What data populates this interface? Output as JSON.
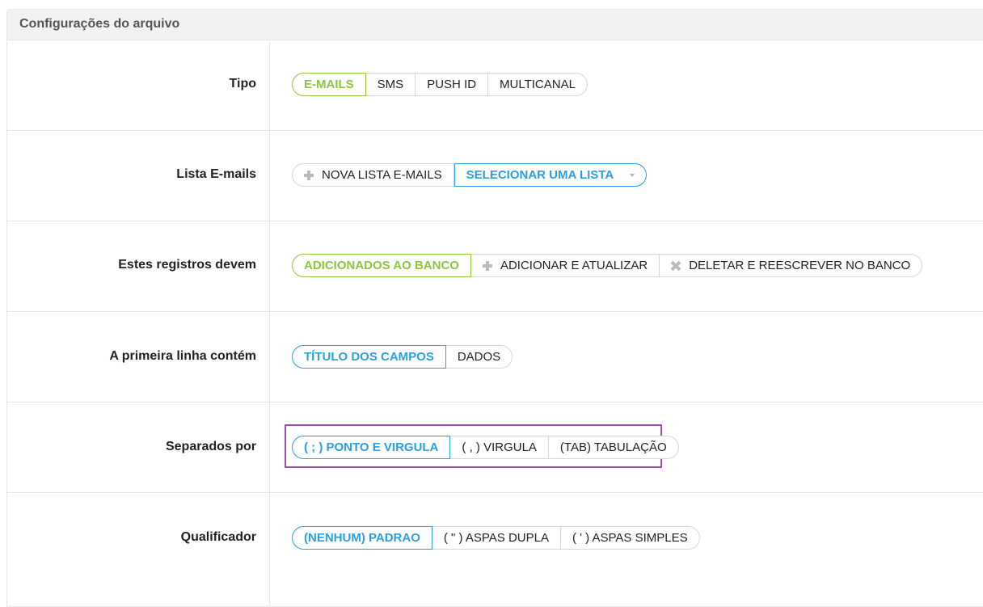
{
  "panel": {
    "title": "Configurações do arquivo"
  },
  "rows": {
    "tipo": {
      "label": "Tipo",
      "options": [
        "E-MAILS",
        "SMS",
        "PUSH ID",
        "MULTICANAL"
      ]
    },
    "lista": {
      "label": "Lista E-mails",
      "new_list": "NOVA LISTA E-MAILS",
      "select_list": "SELECIONAR UMA LISTA"
    },
    "registros": {
      "label": "Estes registros devem",
      "options": [
        "ADICIONADOS AO BANCO",
        "ADICIONAR E ATUALIZAR",
        "DELETAR E REESCREVER NO BANCO"
      ]
    },
    "primeira_linha": {
      "label": "A primeira linha contém",
      "options": [
        "TÍTULO DOS CAMPOS",
        "DADOS"
      ]
    },
    "separados": {
      "label": "Separados por",
      "options": [
        "( ; ) PONTO E VIRGULA",
        "( , ) VIRGULA",
        "(TAB) TABULAÇÃO"
      ]
    },
    "qualificador": {
      "label": "Qualificador",
      "options": [
        "(NENHUM) PADRAO",
        "( \" ) ASPAS DUPLA",
        "( ' ) ASPAS SIMPLES"
      ]
    }
  },
  "colors": {
    "active_green": "#8cc63f",
    "active_blue": "#2b9fe0",
    "highlight": "#9b4fa6"
  }
}
